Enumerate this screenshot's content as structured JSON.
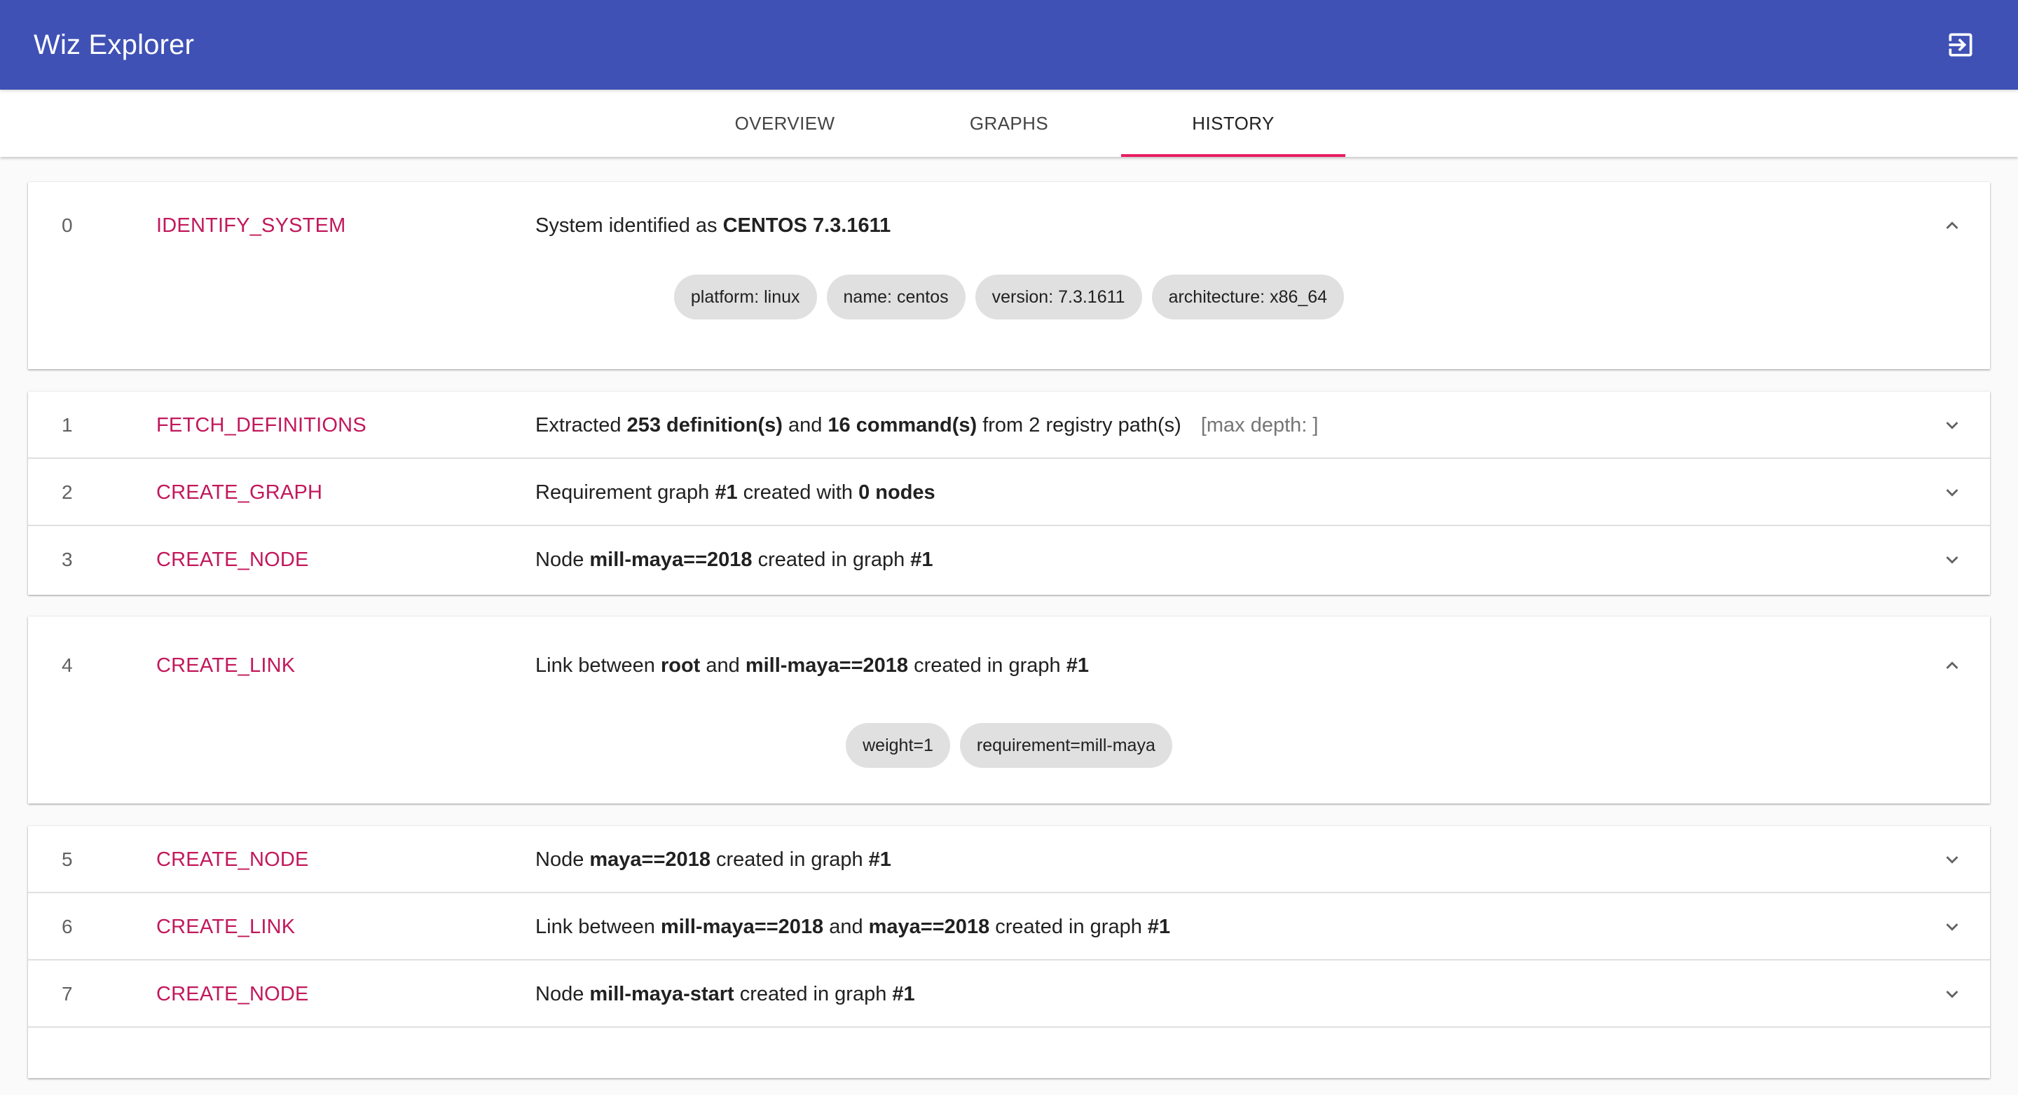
{
  "app": {
    "title": "Wiz Explorer"
  },
  "tabs": {
    "overview": "OVERVIEW",
    "graphs": "GRAPHS",
    "history": "HISTORY"
  },
  "accent": {
    "appbar": "#3f51b5",
    "action": "#c2185b",
    "tab_indicator": "#e91e63"
  },
  "history": [
    {
      "index": "0",
      "action": "IDENTIFY_SYSTEM",
      "t1": "System identified as ",
      "b1": "CENTOS 7.3.1611",
      "expanded": true,
      "chips": [
        "platform: linux",
        "name: centos",
        "version: 7.3.1611",
        "architecture: x86_64"
      ]
    },
    {
      "index": "1",
      "action": "FETCH_DEFINITIONS",
      "t1": "Extracted ",
      "b1": "253 definition(s)",
      "t2": " and ",
      "b2": "16 command(s)",
      "t3": " from 2 registry path(s)",
      "muted": "[max depth: ]"
    },
    {
      "index": "2",
      "action": "CREATE_GRAPH",
      "t1": "Requirement graph ",
      "b1": "#1",
      "t2": " created with ",
      "b2": "0 nodes"
    },
    {
      "index": "3",
      "action": "CREATE_NODE",
      "t1": "Node ",
      "b1": "mill-maya==2018",
      "t2": " created in graph ",
      "b2": "#1"
    },
    {
      "index": "4",
      "action": "CREATE_LINK",
      "t1": "Link between ",
      "b1": "root",
      "t2": " and ",
      "b2": "mill-maya==2018",
      "t3": " created in graph ",
      "b3": "#1",
      "expanded": true,
      "chips": [
        "weight=1",
        "requirement=mill-maya"
      ]
    },
    {
      "index": "5",
      "action": "CREATE_NODE",
      "t1": "Node ",
      "b1": "maya==2018",
      "t2": " created in graph ",
      "b2": "#1"
    },
    {
      "index": "6",
      "action": "CREATE_LINK",
      "t1": "Link between ",
      "b1": "mill-maya==2018",
      "t2": " and ",
      "b2": "maya==2018",
      "t3": " created in graph ",
      "b3": "#1"
    },
    {
      "index": "7",
      "action": "CREATE_NODE",
      "t1": "Node ",
      "b1": "mill-maya-start",
      "t2": " created in graph ",
      "b2": "#1"
    }
  ]
}
